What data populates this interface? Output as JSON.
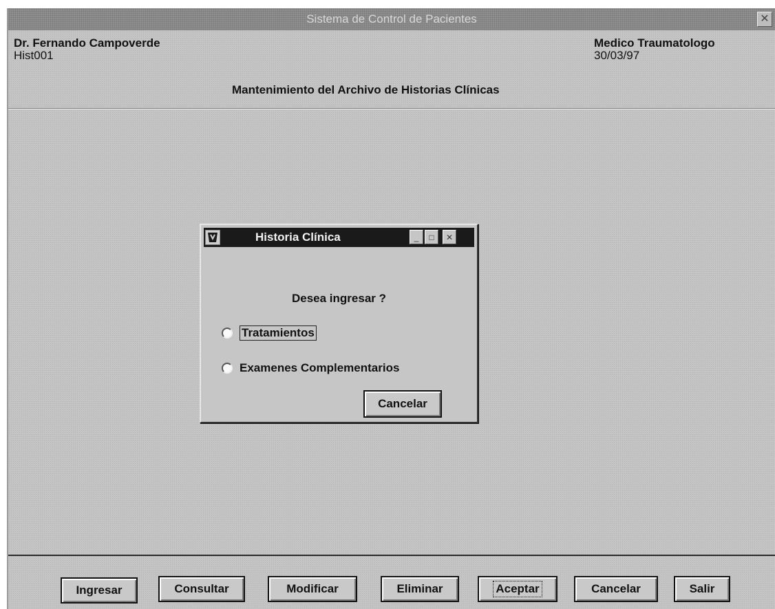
{
  "window": {
    "title": "Sistema de Control de Pacientes",
    "close_glyph": "✕"
  },
  "header": {
    "doctor_name": "Dr. Fernando Campoverde",
    "record_code": "Hist001",
    "specialty": "Medico Traumatologo",
    "date": "30/03/97",
    "screen_title": "Mantenimiento del Archivo de Historias Clínicas"
  },
  "dialog": {
    "title": "Historia Clínica",
    "question": "Desea ingresar ?",
    "options": [
      {
        "label": "Tratamientos",
        "selected": false,
        "focused": true
      },
      {
        "label": "Examenes Complementarios",
        "selected": false,
        "focused": false
      }
    ],
    "cancel_label": "Cancelar",
    "controls": {
      "minimize": "_",
      "maximize": "□",
      "close": "✕"
    }
  },
  "toolbar": {
    "buttons": [
      {
        "id": "ingresar",
        "label": "Ingresar"
      },
      {
        "id": "consultar",
        "label": "Consultar"
      },
      {
        "id": "modificar",
        "label": "Modificar"
      },
      {
        "id": "eliminar",
        "label": "Eliminar"
      },
      {
        "id": "aceptar",
        "label": "Aceptar",
        "focused": true
      },
      {
        "id": "cancelar",
        "label": "Cancelar"
      },
      {
        "id": "salir",
        "label": "Salir"
      }
    ]
  }
}
